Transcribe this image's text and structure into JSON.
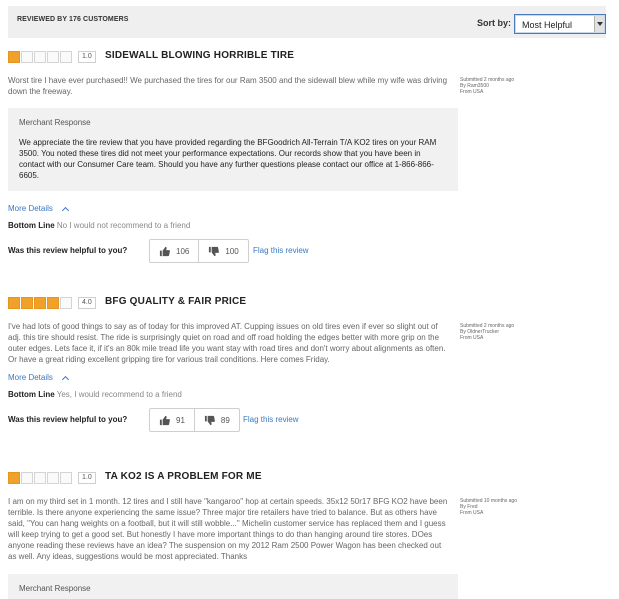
{
  "header": {
    "reviewed_by": "REVIEWED BY 176 CUSTOMERS",
    "sort_label": "Sort by:",
    "sort_value": "Most Helpful"
  },
  "colors": {
    "star": "#f0a12a",
    "link": "#3a78c3",
    "panel": "#f1f1f1"
  },
  "reviews": [
    {
      "rating": 1,
      "score": "1.0",
      "title": "SIDEWALL BLOWING HORRIBLE TIRE",
      "text": "Worst tire I have ever purchased!! We purchased the tires for our Ram 3500 and the sidewall blew while my wife was driving down the freeway.",
      "submitted": "Submitted 2 months ago",
      "by": "By Ram3500",
      "from": "From USA",
      "merchant_heading": "Merchant Response",
      "merchant_text": "We appreciate the tire review that you have provided regarding the BFGoodrich All-Terrain T/A KO2 tires on your RAM 3500. You noted these tires did not meet your performance expectations. Our records show that you have been in contact with our Consumer Care team. Should you have any further questions please contact our office at 1-866-866-6605.",
      "more_details": "More Details",
      "bottom_line_label": "Bottom Line",
      "bottom_line": "No I would not recommend to a friend",
      "helpful_q": "Was this review helpful to you?",
      "up": "106",
      "down": "100",
      "flag": "Flag this review"
    },
    {
      "rating": 4,
      "score": "4.0",
      "title": "BFG QUALITY & FAIR PRICE",
      "text": "I've had lots of good things to say as of today for this improved AT. Cupping issues on old tires even if ever so slight out of adj. this tire should resist. The ride is surprisingly quiet on road and off road holding the edges better with more grip on the outer edges. Lets face it, if it's an 80k mile tread life you want stay with road tires and don't worry about alignments as often. Or have a great riding excellent gripping tire for various trail conditions. Here comes Friday.",
      "submitted": "Submitted 2 months ago",
      "by": "By OldnerTrucker",
      "from": "From USA",
      "more_details": "More Details",
      "bottom_line_label": "Bottom Line",
      "bottom_line": "Yes, I would recommend to a friend",
      "helpful_q": "Was this review helpful to you?",
      "up": "91",
      "down": "89",
      "flag": "Flag this review"
    },
    {
      "rating": 1,
      "score": "1.0",
      "title": "TA KO2 IS A PROBLEM FOR ME",
      "text": "I am on my third set in 1 month. 12 tires and I still have \"kangaroo\" hop at certain speeds. 35x12 50r17 BFG KO2 have been terrible. Is there anyone experiencing the same issue? Three major tire retailers have tried to balance. But as others have said, \"You can hang weights on a football, but it will still wobble...\" Michelin customer service has replaced them and I guess will keep trying to get a good set. But honestly I have more important things to do than hanging around tire stores. DOes anyone reading these reviews have an idea? The suspension on my 2012 Ram 2500 Power Wagon has been checked out as well. Any ideas, suggestions would be most appreciated. Thanks",
      "submitted": "Submitted 10 months ago",
      "by": "By Fred",
      "from": "From USA",
      "merchant_heading": "Merchant Response"
    }
  ]
}
